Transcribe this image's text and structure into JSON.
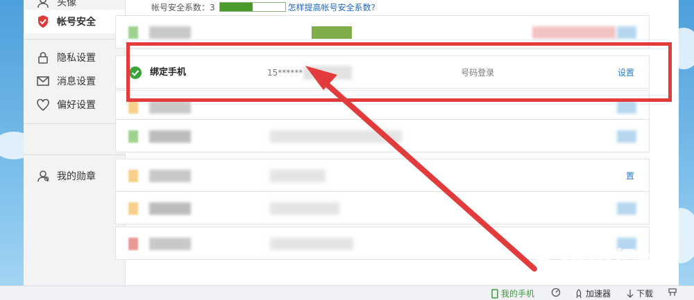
{
  "sidebar": {
    "items": [
      {
        "label": "头像",
        "icon": "user-icon"
      },
      {
        "label": "帐号安全",
        "icon": "shield-icon",
        "active": true
      },
      {
        "label": "隐私设置",
        "icon": "lock-icon"
      },
      {
        "label": "消息设置",
        "icon": "mail-icon"
      },
      {
        "label": "偏好设置",
        "icon": "heart-icon"
      },
      {
        "label": "我的勋章",
        "icon": "medal-icon"
      }
    ]
  },
  "security": {
    "score_label": "帐号安全系数：3",
    "score_fraction": 0.5,
    "improve_link": "怎样提高帐号安全系数?"
  },
  "phone_row": {
    "title": "绑定手机",
    "value": "15******　　　　　　　　　　　　　　　　　　　号码登录",
    "action": "设置"
  },
  "partial_action": "置",
  "statusbar": {
    "my_phone": "我的手机",
    "accelerator": "加速器",
    "download": "下载"
  },
  "watermark": {
    "main": "Baidu经验",
    "sub": "jingyan.baidu.com"
  },
  "colors": {
    "accent": "#2b7bc8",
    "highlight_border": "#e23b3b",
    "score_fill": "#4a9a2c",
    "check_green": "#3aa33a"
  }
}
